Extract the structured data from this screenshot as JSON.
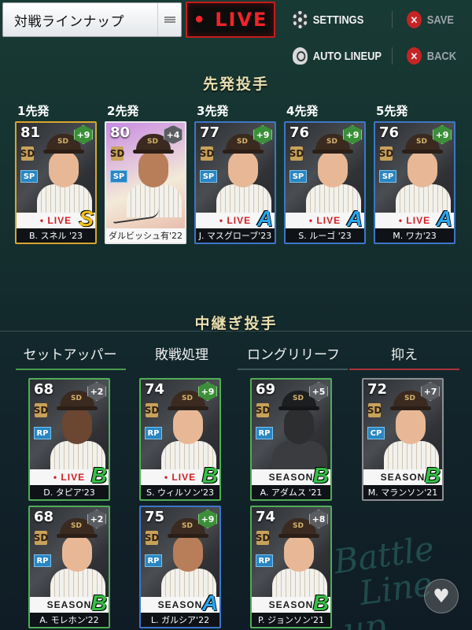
{
  "header": {
    "lineup_title": "対戦ラインナップ",
    "mode_label": "• LIVE",
    "settings_label": "SETTINGS",
    "save_label": "SAVE",
    "auto_lineup_label": "AUTO LINEUP",
    "back_label": "BACK"
  },
  "starters": {
    "section_title": "先発投手",
    "cards": [
      {
        "slot": "1先発",
        "ovr": "81",
        "boost": "+9",
        "pos": "SP",
        "type": "• LIVE",
        "grade": "S",
        "name": "B. スネル '23"
      },
      {
        "slot": "2先発",
        "ovr": "80",
        "boost": "+4",
        "pos": "SP",
        "type": "",
        "grade": "",
        "name": "ダルビッシュ有'22"
      },
      {
        "slot": "3先発",
        "ovr": "77",
        "boost": "+9",
        "pos": "SP",
        "type": "• LIVE",
        "grade": "A",
        "name": "J. マスグローブ'23"
      },
      {
        "slot": "4先発",
        "ovr": "76",
        "boost": "+9",
        "pos": "SP",
        "type": "• LIVE",
        "grade": "A",
        "name": "S. ルーゴ '23"
      },
      {
        "slot": "5先発",
        "ovr": "76",
        "boost": "+9",
        "pos": "SP",
        "type": "• LIVE",
        "grade": "A",
        "name": "M. ワカ'23"
      }
    ]
  },
  "relievers": {
    "section_title": "中継ぎ投手",
    "tabs": [
      "セットアッパー",
      "敗戦処理",
      "ロングリリーフ",
      "抑え"
    ],
    "cards": [
      {
        "ovr": "68",
        "boost": "+2",
        "pos": "RP",
        "type": "• LIVE",
        "grade": "B",
        "name": "D. タピア'23"
      },
      {
        "ovr": "74",
        "boost": "+9",
        "pos": "RP",
        "type": "• LIVE",
        "grade": "B",
        "name": "S. ウィルソン'23"
      },
      {
        "ovr": "69",
        "boost": "+5",
        "pos": "RP",
        "type": "SEASON",
        "grade": "B",
        "name": "A. アダムス '21"
      },
      {
        "ovr": "72",
        "boost": "+7",
        "pos": "CP",
        "type": "SEASON",
        "grade": "B",
        "name": "M. マランソン'21"
      },
      {
        "ovr": "68",
        "boost": "+2",
        "pos": "RP",
        "type": "SEASON",
        "grade": "B",
        "name": "A. モレホン'22"
      },
      {
        "ovr": "75",
        "boost": "+9",
        "pos": "RP",
        "type": "SEASON",
        "grade": "A",
        "name": "L. ガルシア'22"
      },
      {
        "ovr": "74",
        "boost": "+8",
        "pos": "RP",
        "type": "SEASON",
        "grade": "B",
        "name": "P. ジョンソン'21"
      }
    ]
  },
  "colors": {
    "live_red": "#f2232a",
    "tab_underline_green": "#4c9b4f",
    "tab_underline_red": "#a8343a",
    "title_gold": "#e7dfb0"
  }
}
